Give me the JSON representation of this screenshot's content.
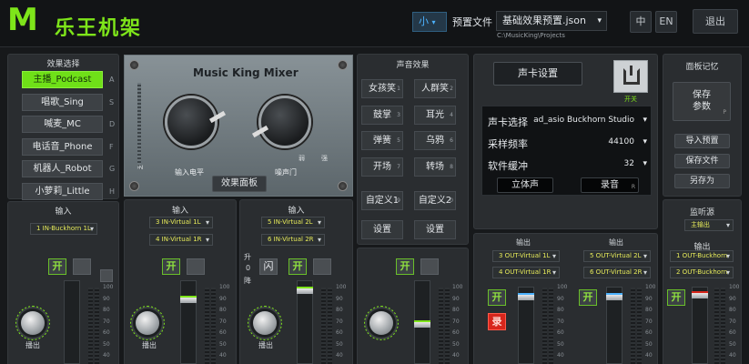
{
  "header": {
    "logo_mark": "M",
    "logo_text": "乐王机架",
    "size_select": "小",
    "preset_label": "预置文件",
    "preset_value": "基础效果预置.json",
    "preset_path": "C:\\MusicKing\\Projects",
    "lang_zh": "中",
    "lang_en": "EN",
    "exit": "退出"
  },
  "effect_select": {
    "title": "效果选择",
    "items": [
      {
        "label": "主播_Podcast",
        "key": "A"
      },
      {
        "label": "唱歌_Sing",
        "key": "S"
      },
      {
        "label": "喊麦_MC",
        "key": "D"
      },
      {
        "label": "电话音_Phone",
        "key": "F"
      },
      {
        "label": "机器人_Robot",
        "key": "G"
      },
      {
        "label": "小萝莉_Little",
        "key": "H"
      }
    ]
  },
  "mixer": {
    "title": "Music King Mixer",
    "knob1": "输入电平",
    "knob2": "噪声门",
    "scale_in": "IN",
    "scale_weak": "弱",
    "scale_strong": "强",
    "panel_btn": "效果面板"
  },
  "input_left": {
    "title": "输入",
    "dd1": "1 IN-Buckhorn 1L",
    "on": "开",
    "knob": "播出"
  },
  "input_mid": {
    "title": "输入",
    "dd1": "3 IN-Virtual 1L",
    "dd2": "4 IN-Virtual 1R",
    "on": "开",
    "knob": "播出"
  },
  "input_right": {
    "title": "输入",
    "dd1": "5 IN-Virtual 2L",
    "dd2": "6 IN-Virtual 2R",
    "on": "开",
    "flash": "闪",
    "side_up": "升",
    "side_num": "0",
    "side_down": "降",
    "knob": "播出"
  },
  "sound_fx": {
    "title": "声音效果",
    "buttons": [
      {
        "label": "女孩笑",
        "num": "1"
      },
      {
        "label": "人群笑",
        "num": "2"
      },
      {
        "label": "鼓掌",
        "num": "3"
      },
      {
        "label": "耳光",
        "num": "4"
      },
      {
        "label": "弹簧",
        "num": "5"
      },
      {
        "label": "乌鸦",
        "num": "6"
      },
      {
        "label": "开场",
        "num": "7"
      },
      {
        "label": "转场",
        "num": "8"
      },
      {
        "label": "自定义1",
        "num": "9"
      },
      {
        "label": "自定义2",
        "num": "0"
      },
      {
        "label": "设置",
        "num": ""
      },
      {
        "label": "设置",
        "num": ""
      }
    ],
    "on": "开"
  },
  "soundcard": {
    "title_btn": "声卡设置",
    "power_label": "开关",
    "rows": [
      {
        "label": "声卡选择",
        "value": "ad_asio Buckhorn Studio"
      },
      {
        "label": "采样频率",
        "value": "44100"
      },
      {
        "label": "软件缓冲",
        "value": "32"
      }
    ],
    "stereo": "立体声",
    "record": "录音",
    "record_key": "R"
  },
  "panel_memory": {
    "title": "面板记忆",
    "save_params": "保存\n参数",
    "save_key": "P",
    "import": "导入预置",
    "save_file": "保存文件",
    "save_as": "另存为"
  },
  "output_mid": {
    "title1": "输出",
    "dd1": "3 OUT-Virtual 1L",
    "dd2": "4 OUT-Virtual 1R",
    "title2": "输出",
    "dd3": "5 OUT-Virtual 2L",
    "dd4": "6 OUT-Virtual 2R",
    "on": "开",
    "rec": "录",
    "on2": "开"
  },
  "monitor": {
    "title": "监听源",
    "source": "主输出",
    "out_title": "输出",
    "dd1": "1 OUT-Buckhorn",
    "dd2": "2 OUT-Buckhorn",
    "on": "开"
  },
  "scale": [
    "100",
    "90",
    "80",
    "70",
    "60",
    "50",
    "40"
  ],
  "colors": {
    "accent": "#7ee51a",
    "bg": "#17191b",
    "panel": "#2a2d30",
    "record": "#d8261c"
  }
}
